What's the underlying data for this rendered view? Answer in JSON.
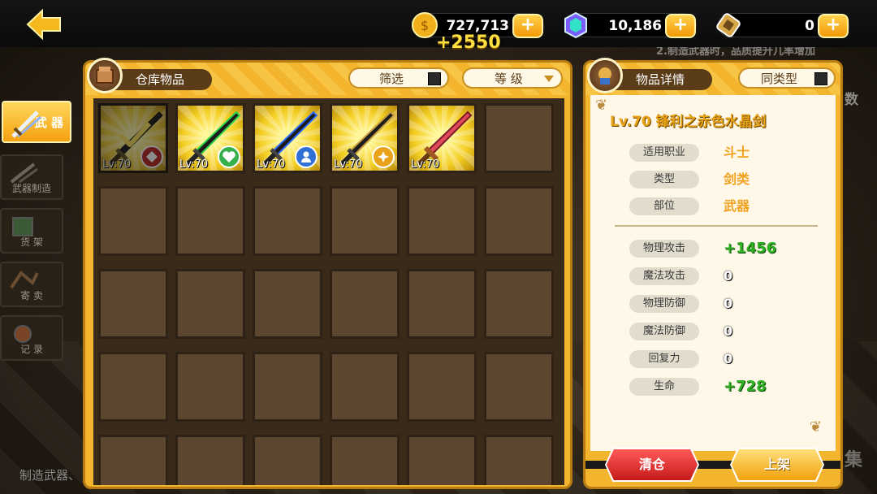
{
  "topbar": {
    "gold": "727,713",
    "gems": "10,186",
    "tickets": "0",
    "plus": "+",
    "gold_gain": "+2550"
  },
  "background": {
    "hint_text": "2.制造武器时，品质提升几率增加",
    "side_text": "数",
    "corner_text": "集"
  },
  "sidenav": {
    "items": [
      {
        "label": "武 器",
        "icon": "weapon-icon",
        "active": true
      },
      {
        "label": "武器制造",
        "icon": "forge-icon",
        "active": false
      },
      {
        "label": "货 架",
        "icon": "shelf-icon",
        "active": false
      },
      {
        "label": "寄 卖",
        "icon": "consign-icon",
        "active": false
      },
      {
        "label": "记 录",
        "icon": "record-icon",
        "active": false
      }
    ],
    "caption": "制造武器、"
  },
  "inventory": {
    "title": "仓库物品",
    "filter_label": "筛选",
    "sort_label": "等 级",
    "items": [
      {
        "level": "Lv:70",
        "badge": "red-shield",
        "selected": true
      },
      {
        "level": "Lv:70",
        "badge": "green-heart",
        "selected": false
      },
      {
        "level": "Lv:70",
        "badge": "blue-person",
        "selected": false
      },
      {
        "level": "Lv:70",
        "badge": "gold-star",
        "selected": false
      },
      {
        "level": "Lv:70",
        "badge": "",
        "selected": false
      }
    ]
  },
  "detail": {
    "title": "物品详情",
    "same_type_label": "同类型",
    "item_name": "Lv.70 锋利之赤色水晶剑",
    "info": [
      {
        "label": "适用职业",
        "value": "斗士"
      },
      {
        "label": "类型",
        "value": "剑类"
      },
      {
        "label": "部位",
        "value": "武器"
      }
    ],
    "stats": [
      {
        "label": "物理攻击",
        "value": "+1456",
        "style": "green"
      },
      {
        "label": "魔法攻击",
        "value": "0",
        "style": "white"
      },
      {
        "label": "物理防御",
        "value": "0",
        "style": "white"
      },
      {
        "label": "魔法防御",
        "value": "0",
        "style": "white"
      },
      {
        "label": "回复力",
        "value": "0",
        "style": "white"
      },
      {
        "label": "生命",
        "value": "+728",
        "style": "green"
      }
    ],
    "clear_button": "清仓",
    "list_button": "上架"
  }
}
